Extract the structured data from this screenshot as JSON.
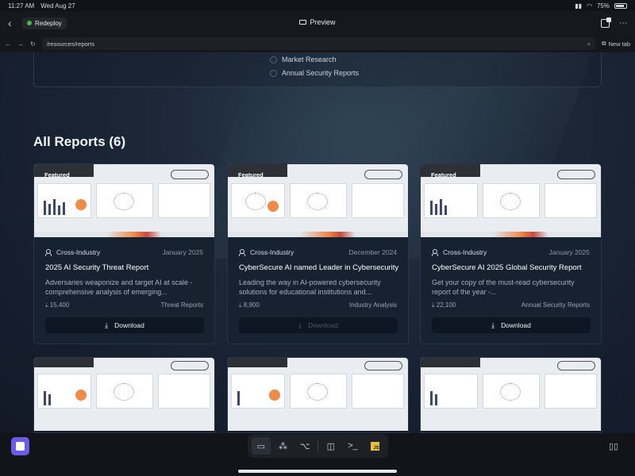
{
  "statusbar": {
    "time": "11:27 AM",
    "date": "Wed Aug 27",
    "battery": "75%"
  },
  "topbar": {
    "back": "‹",
    "project": "Redeploy",
    "preview": "Preview"
  },
  "addressbar": {
    "url": "/resources/reports",
    "new_tab": "New tab"
  },
  "filters": {
    "options": [
      "Market Research",
      "Annual Security Reports"
    ]
  },
  "page": {
    "heading": "All Reports (6)"
  },
  "cards": [
    {
      "badge": "Featured",
      "industry": "Cross-Industry",
      "date": "January 2025",
      "title": "2025 AI Security Threat Report",
      "description": "Adversaries weaponize and target AI at scale - comprehensive analysis of emerging...",
      "downloads": "15,400",
      "category": "Threat Reports",
      "button": "Download"
    },
    {
      "badge": "Featured",
      "industry": "Cross-Industry",
      "date": "December 2024",
      "title": "CyberSecure AI named Leader in Cybersecurity",
      "description": "Leading the way in AI-powered cybersecurity solutions for educational institutions and...",
      "downloads": "8,900",
      "category": "Industry Analysis",
      "button": "Download"
    },
    {
      "badge": "Featured",
      "industry": "Cross-Industry",
      "date": "January 2025",
      "title": "CyberSecure AI 2025 Global Security Report",
      "description": "Get your copy of the must-read cybersecurity report of the year -...",
      "downloads": "22,100",
      "category": "Annual Security Reports",
      "button": "Download"
    }
  ],
  "dock": {
    "tools": [
      "monitor-icon",
      "grid-icon",
      "tree-icon",
      "database-icon",
      "terminal-icon",
      "js-icon"
    ],
    "js_label": "JS"
  }
}
